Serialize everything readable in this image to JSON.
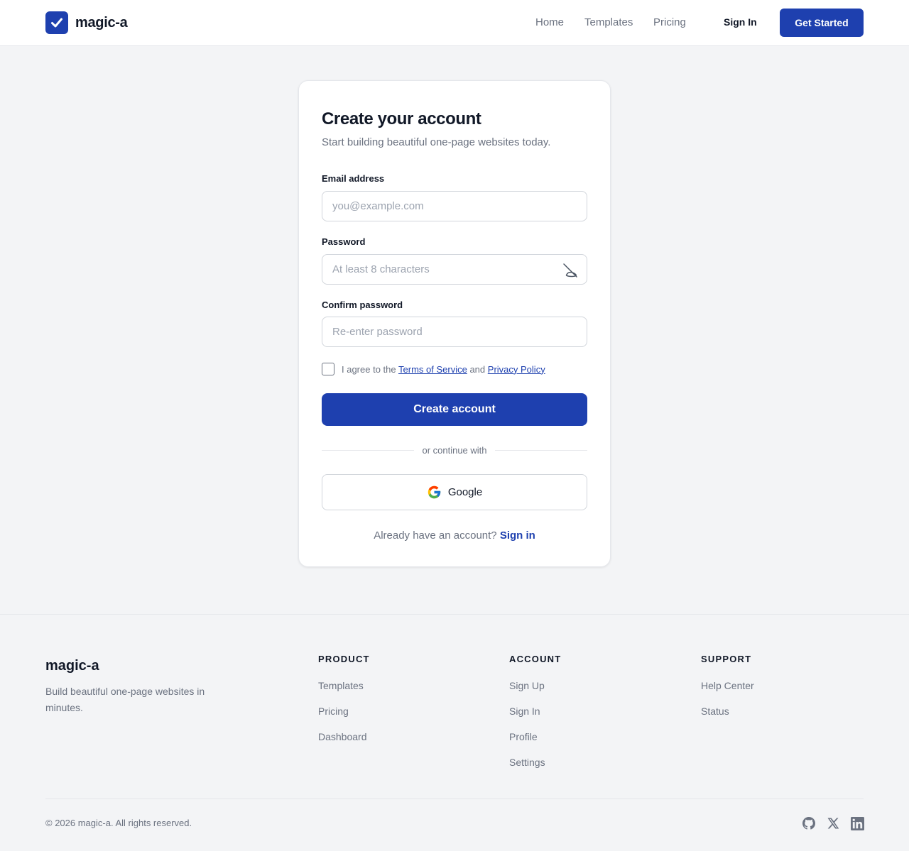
{
  "header": {
    "brand": "magic-a",
    "nav": [
      "Home",
      "Templates",
      "Pricing"
    ],
    "sign_in": "Sign In",
    "get_started": "Get Started"
  },
  "form": {
    "title": "Create your account",
    "subtitle": "Start building beautiful one-page websites today.",
    "email_label": "Email address",
    "email_placeholder": "you@example.com",
    "password_label": "Password",
    "password_placeholder": "At least 8 characters",
    "confirm_label": "Confirm password",
    "confirm_placeholder": "Re-enter password",
    "agree_prefix": "I agree to the",
    "terms": "Terms of Service",
    "and": "and",
    "privacy": "Privacy Policy",
    "submit": "Create account",
    "divider": "or continue with",
    "google": "Google",
    "already": "Already have an account?",
    "sign_in": "Sign in"
  },
  "footer": {
    "brand": "magic-a",
    "description": "Build beautiful one-page websites in minutes.",
    "columns": [
      {
        "heading": "PRODUCT",
        "links": [
          "Templates",
          "Pricing",
          "Dashboard"
        ]
      },
      {
        "heading": "ACCOUNT",
        "links": [
          "Sign Up",
          "Sign In",
          "Profile",
          "Settings"
        ]
      },
      {
        "heading": "SUPPORT",
        "links": [
          "Help Center",
          "Status"
        ]
      }
    ],
    "copyright": "© 2026 magic-a. All rights reserved.",
    "social_icons": [
      "github-icon",
      "x-icon",
      "linkedin-icon"
    ]
  },
  "colors": {
    "primary": "#1e40af",
    "text": "#111827",
    "muted": "#6b7280",
    "background": "#f3f4f6"
  }
}
